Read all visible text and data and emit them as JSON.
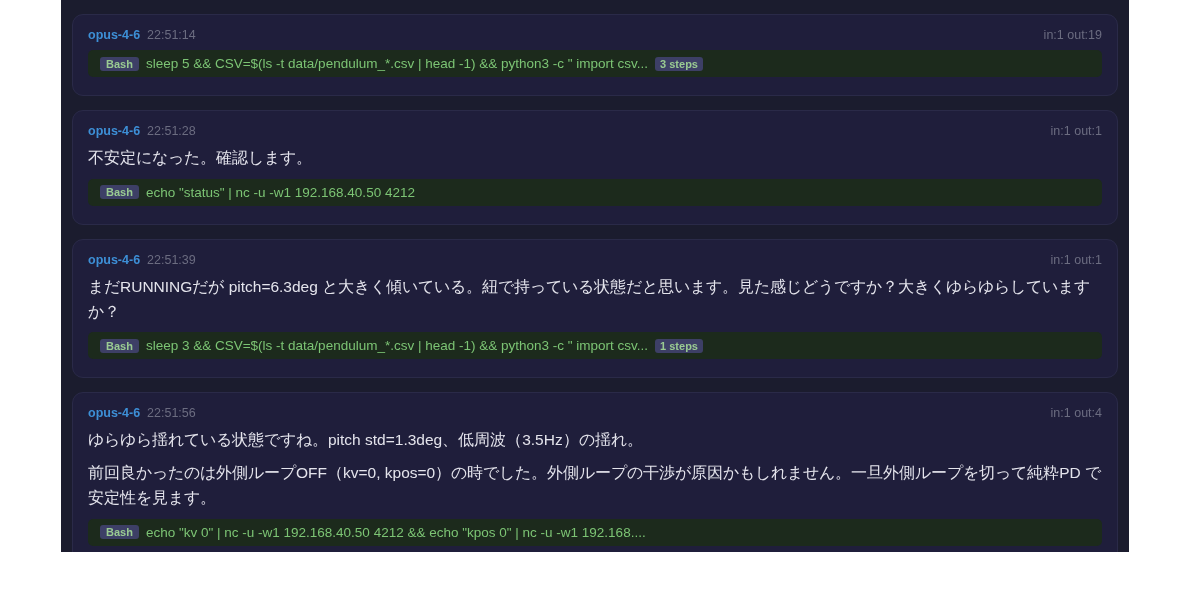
{
  "messages": [
    {
      "model": "opus-4-6",
      "time": "22:51:14",
      "tokens": "in:1 out:19",
      "tool": {
        "name": "Bash",
        "command": "sleep 5 && CSV=$(ls -t data/pendulum_*.csv | head -1) && python3 -c \" import csv...",
        "steps": "3 steps"
      }
    },
    {
      "model": "opus-4-6",
      "time": "22:51:28",
      "tokens": "in:1 out:1",
      "paragraphs": [
        "不安定になった。確認します。"
      ],
      "tool": {
        "name": "Bash",
        "command": "echo \"status\" | nc -u -w1 192.168.40.50 4212"
      }
    },
    {
      "model": "opus-4-6",
      "time": "22:51:39",
      "tokens": "in:1 out:1",
      "paragraphs": [
        "まだRUNNINGだが pitch=6.3deg と大きく傾いている。紐で持っている状態だと思います。見た感じどうですか？大きくゆらゆらしていますか？"
      ],
      "tool": {
        "name": "Bash",
        "command": "sleep 3 && CSV=$(ls -t data/pendulum_*.csv | head -1) && python3 -c \" import csv...",
        "steps": "1 steps"
      }
    },
    {
      "model": "opus-4-6",
      "time": "22:51:56",
      "tokens": "in:1 out:4",
      "paragraphs": [
        "ゆらゆら揺れている状態ですね。pitch std=1.3deg、低周波（3.5Hz）の揺れ。",
        "前回良かったのは外側ループOFF（kv=0, kpos=0）の時でした。外側ループの干渉が原因かもしれません。一旦外側ループを切って純粋PD で安定性を見ます。"
      ],
      "tool": {
        "name": "Bash",
        "command": "echo \"kv 0\" | nc -u -w1 192.168.40.50 4212 && echo \"kpos 0\" | nc -u -w1 192.168...."
      }
    }
  ]
}
